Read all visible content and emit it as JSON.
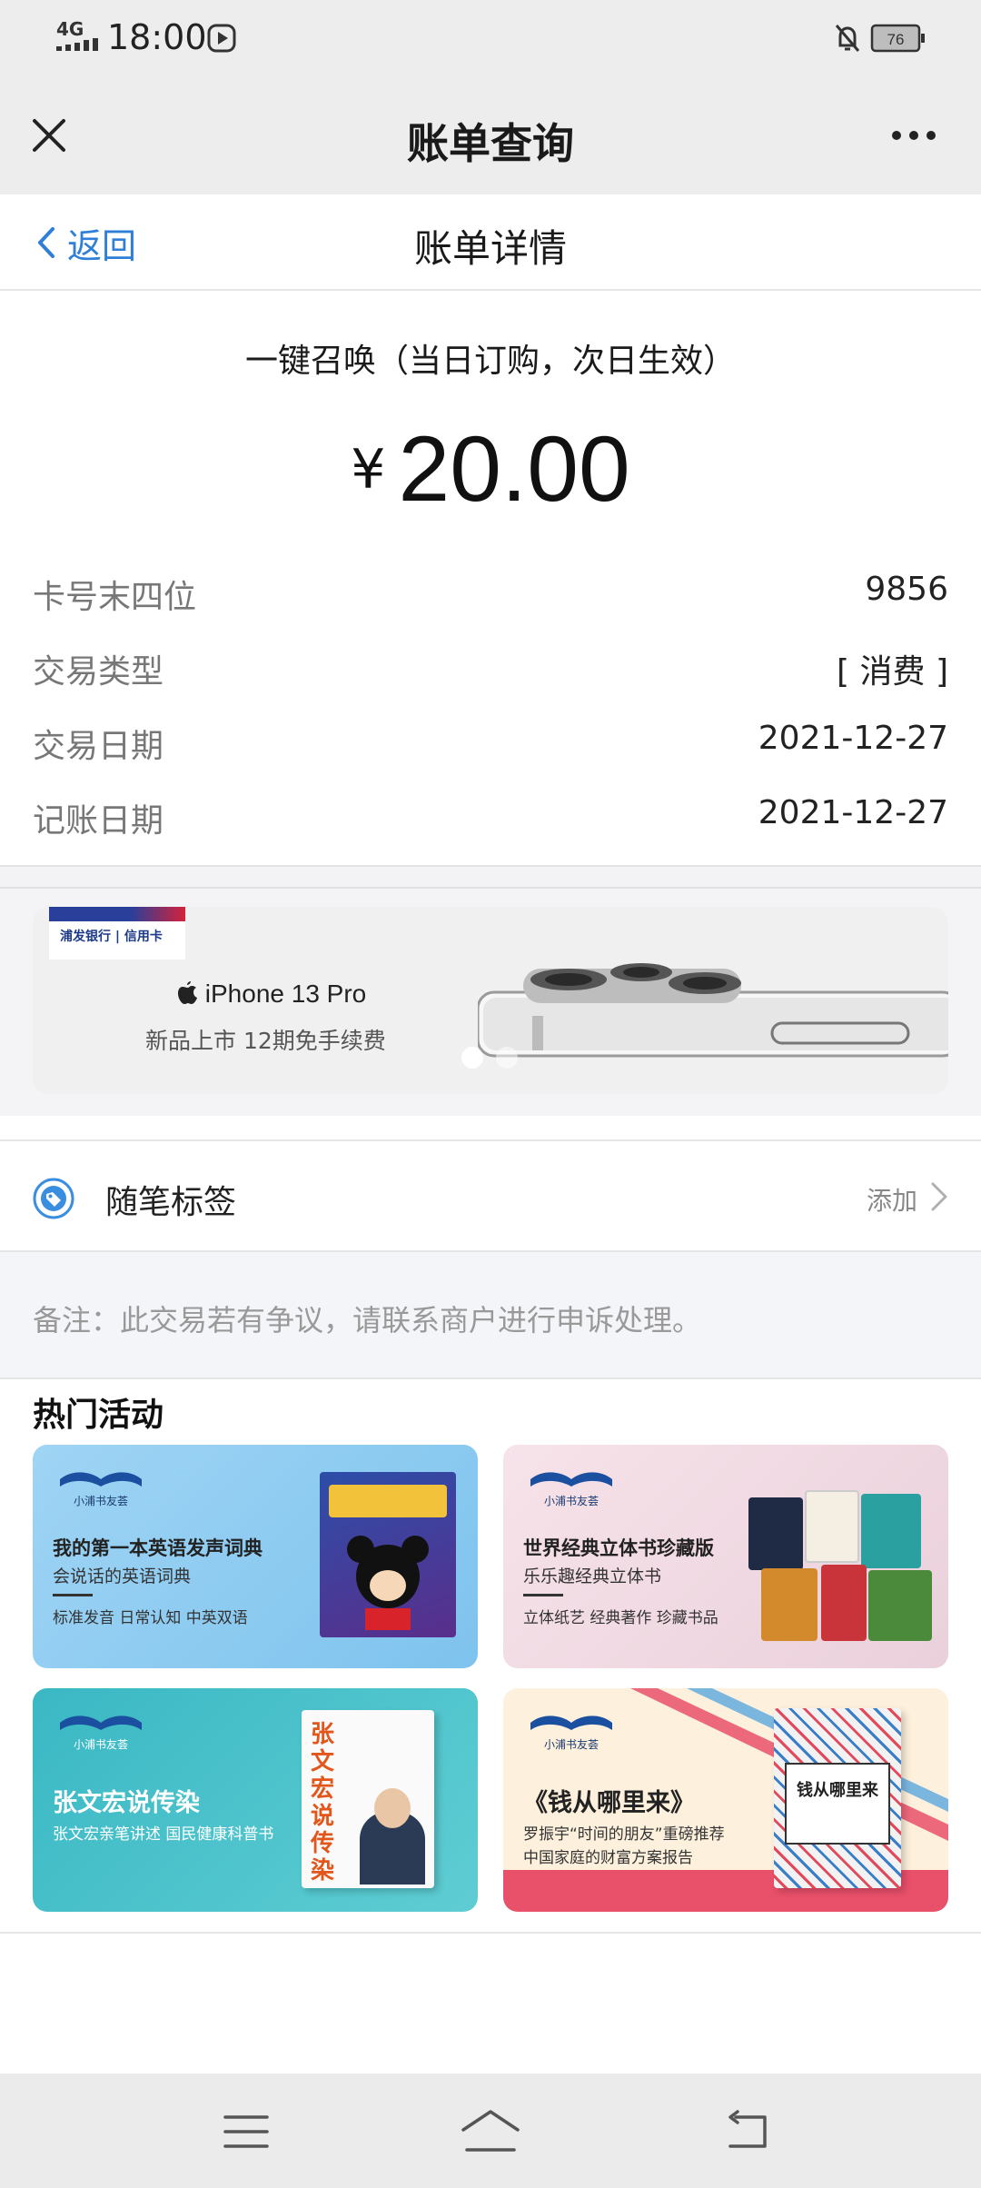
{
  "status_bar": {
    "network": "4G",
    "time": "18:00",
    "battery": "76"
  },
  "title_bar": {
    "title": "账单查询"
  },
  "sub_nav": {
    "back_label": "返回",
    "title": "账单详情"
  },
  "bill": {
    "item_name": "一键召唤（当日订购，次日生效）",
    "currency": "¥",
    "amount": "20.00",
    "rows": [
      {
        "label": "卡号末四位",
        "value": "9856"
      },
      {
        "label": "交易类型",
        "value": "[ 消费 ]"
      },
      {
        "label": "交易日期",
        "value": "2021-12-27"
      },
      {
        "label": "记账日期",
        "value": "2021-12-27"
      }
    ]
  },
  "banner": {
    "bank_logo_text": "浦发银行 | 信用卡",
    "headline": "iPhone 13 Pro",
    "subtitle": "新品上市 12期免手续费",
    "active_slide": 1,
    "slide_count": 2
  },
  "tag_row": {
    "label": "随笔标签",
    "action": "添加"
  },
  "remark": {
    "text": "备注：此交易若有争议，请联系商户进行申诉处理。"
  },
  "hot": {
    "title": "热门活动",
    "cards": [
      {
        "brand": "小浦书友荟",
        "title": "我的第一本英语发声词典",
        "subtitle": "会说话的英语词典",
        "tags": "标准发音 日常认知 中英双语"
      },
      {
        "brand": "小浦书友荟",
        "title": "世界经典立体书珍藏版",
        "subtitle": "乐乐趣经典立体书",
        "tags": "立体纸艺 经典著作 珍藏书品"
      },
      {
        "brand": "小浦书友荟",
        "title": "张文宏说传染",
        "subtitle": "张文宏亲笔讲述 国民健康科普书",
        "book_text": "张文宏说传染"
      },
      {
        "brand": "小浦书友荟",
        "title": "《钱从哪里来》",
        "subtitle": "罗振宇“时间的朋友”重磅推荐",
        "tags": "中国家庭的财富方案报告",
        "book_text": "钱从哪里来"
      }
    ]
  },
  "colors": {
    "accent_blue": "#2f7fd8",
    "title_bar_bg": "#ededed",
    "page_bg": "#ffffff"
  }
}
